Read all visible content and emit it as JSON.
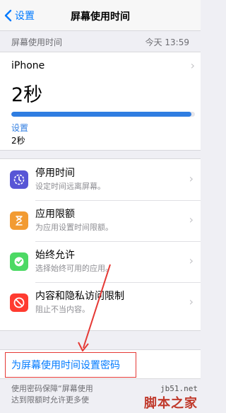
{
  "nav": {
    "back_label": "设置",
    "title": "屏幕使用时间"
  },
  "summary": {
    "header_left": "屏幕使用时间",
    "header_right": "今天 13:59",
    "device": "iPhone",
    "total_time": "2秒",
    "usage_fraction": 0.98,
    "bar_color": "#2f7de1",
    "category_label": "设置",
    "category_value": "2秒"
  },
  "options": [
    {
      "title": "停用时间",
      "subtitle": "设定时间远离屏幕。",
      "icon": "moon-clock-icon",
      "color": "#5856d6"
    },
    {
      "title": "应用限额",
      "subtitle": "为应用设置时间限额。",
      "icon": "hourglass-icon",
      "color": "#f29b32"
    },
    {
      "title": "始终允许",
      "subtitle": "选择始终可用的应用。",
      "icon": "checkmark-badge-icon",
      "color": "#4cd964"
    },
    {
      "title": "内容和隐私访问限制",
      "subtitle": "阻止不当内容。",
      "icon": "no-entry-icon",
      "color": "#ff3b30"
    }
  ],
  "passcode": {
    "label": "为屏幕使用时间设置密码"
  },
  "footer": {
    "line1": "使用密码保障“屏幕使用",
    "line2": "达到限额时允许更多使"
  },
  "watermark": {
    "site": "jb51.net",
    "brand": "脚本之家"
  },
  "colors": {
    "accent": "#007aff",
    "annotation": "#e53935"
  }
}
